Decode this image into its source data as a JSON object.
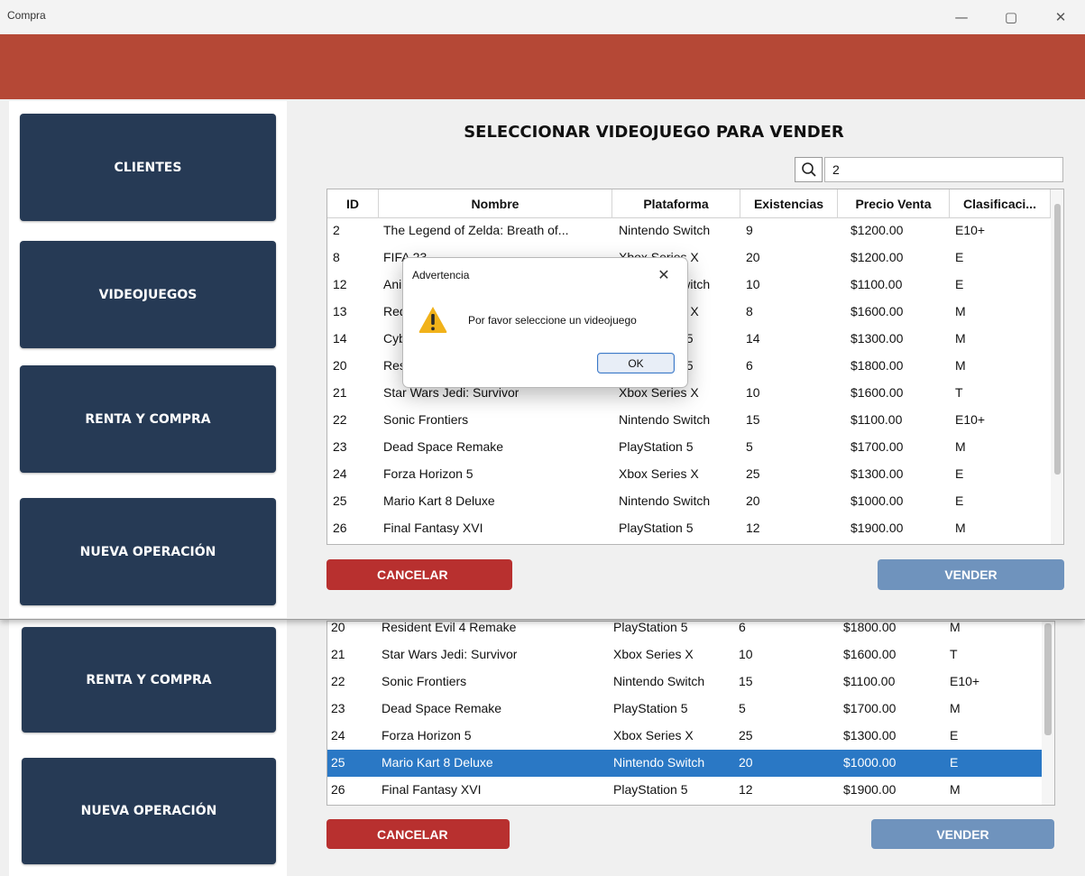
{
  "window": {
    "title": "Compra",
    "minimize_glyph": "—",
    "maximize_glyph": "▢",
    "close_glyph": "✕"
  },
  "colors": {
    "banner": "#b54836",
    "nav_button": "#263a55",
    "cancel": "#b8302f",
    "sell": "#6f93bd",
    "selected_row": "#2a78c5"
  },
  "sidebar": {
    "items": [
      {
        "label": "CLIENTES"
      },
      {
        "label": "VIDEOJUEGOS"
      },
      {
        "label": "RENTA Y COMPRA"
      },
      {
        "label": "NUEVA OPERACIÓN"
      }
    ]
  },
  "main": {
    "heading": "SELECCIONAR VIDEOJUEGO PARA VENDER",
    "search": {
      "icon": "search-icon",
      "value": "2"
    },
    "columns": [
      "ID",
      "Nombre",
      "Plataforma",
      "Existencias",
      "Precio Venta",
      "Clasificaci..."
    ],
    "rows": [
      [
        "2",
        "The Legend of Zelda: Breath of...",
        "Nintendo Switch",
        "9",
        "$1200.00",
        "E10+"
      ],
      [
        "8",
        "FIFA 23",
        "Xbox Series X",
        "20",
        "$1200.00",
        "E"
      ],
      [
        "12",
        "Animal Crossing",
        "Nintendo Switch",
        "10",
        "$1100.00",
        "E"
      ],
      [
        "13",
        "Red Dead Redemption 2",
        "Xbox Series X",
        "8",
        "$1600.00",
        "M"
      ],
      [
        "14",
        "Cyberpunk 2077",
        "PlayStation 5",
        "14",
        "$1300.00",
        "M"
      ],
      [
        "20",
        "Resident Evil 4 Remake",
        "PlayStation 5",
        "6",
        "$1800.00",
        "M"
      ],
      [
        "21",
        "Star Wars Jedi: Survivor",
        "Xbox Series X",
        "10",
        "$1600.00",
        "T"
      ],
      [
        "22",
        "Sonic Frontiers",
        "Nintendo Switch",
        "15",
        "$1100.00",
        "E10+"
      ],
      [
        "23",
        "Dead Space Remake",
        "PlayStation 5",
        "5",
        "$1700.00",
        "M"
      ],
      [
        "24",
        "Forza Horizon 5",
        "Xbox Series X",
        "25",
        "$1300.00",
        "E"
      ],
      [
        "25",
        "Mario Kart 8 Deluxe",
        "Nintendo Switch",
        "20",
        "$1000.00",
        "E"
      ],
      [
        "26",
        "Final Fantasy XVI",
        "PlayStation 5",
        "12",
        "$1900.00",
        "M"
      ]
    ],
    "cancel_label": "CANCELAR",
    "sell_label": "VENDER"
  },
  "background_window": {
    "sidebar": [
      {
        "label": "RENTA Y COMPRA"
      },
      {
        "label": "NUEVA OPERACIÓN"
      }
    ],
    "rows": [
      [
        "20",
        "Resident Evil 4 Remake",
        "PlayStation 5",
        "6",
        "$1800.00",
        "M"
      ],
      [
        "21",
        "Star Wars Jedi: Survivor",
        "Xbox Series X",
        "10",
        "$1600.00",
        "T"
      ],
      [
        "22",
        "Sonic Frontiers",
        "Nintendo Switch",
        "15",
        "$1100.00",
        "E10+"
      ],
      [
        "23",
        "Dead Space Remake",
        "PlayStation 5",
        "5",
        "$1700.00",
        "M"
      ],
      [
        "24",
        "Forza Horizon 5",
        "Xbox Series X",
        "25",
        "$1300.00",
        "E"
      ],
      [
        "25",
        "Mario Kart 8 Deluxe",
        "Nintendo Switch",
        "20",
        "$1000.00",
        "E"
      ],
      [
        "26",
        "Final Fantasy XVI",
        "PlayStation 5",
        "12",
        "$1900.00",
        "M"
      ]
    ],
    "selected_row_id": "25",
    "cancel_label": "CANCELAR",
    "sell_label": "VENDER"
  },
  "dialog": {
    "title": "Advertencia",
    "message": "Por favor seleccione un videojuego",
    "ok_label": "OK",
    "close_glyph": "✕",
    "icon": "warning-icon"
  }
}
